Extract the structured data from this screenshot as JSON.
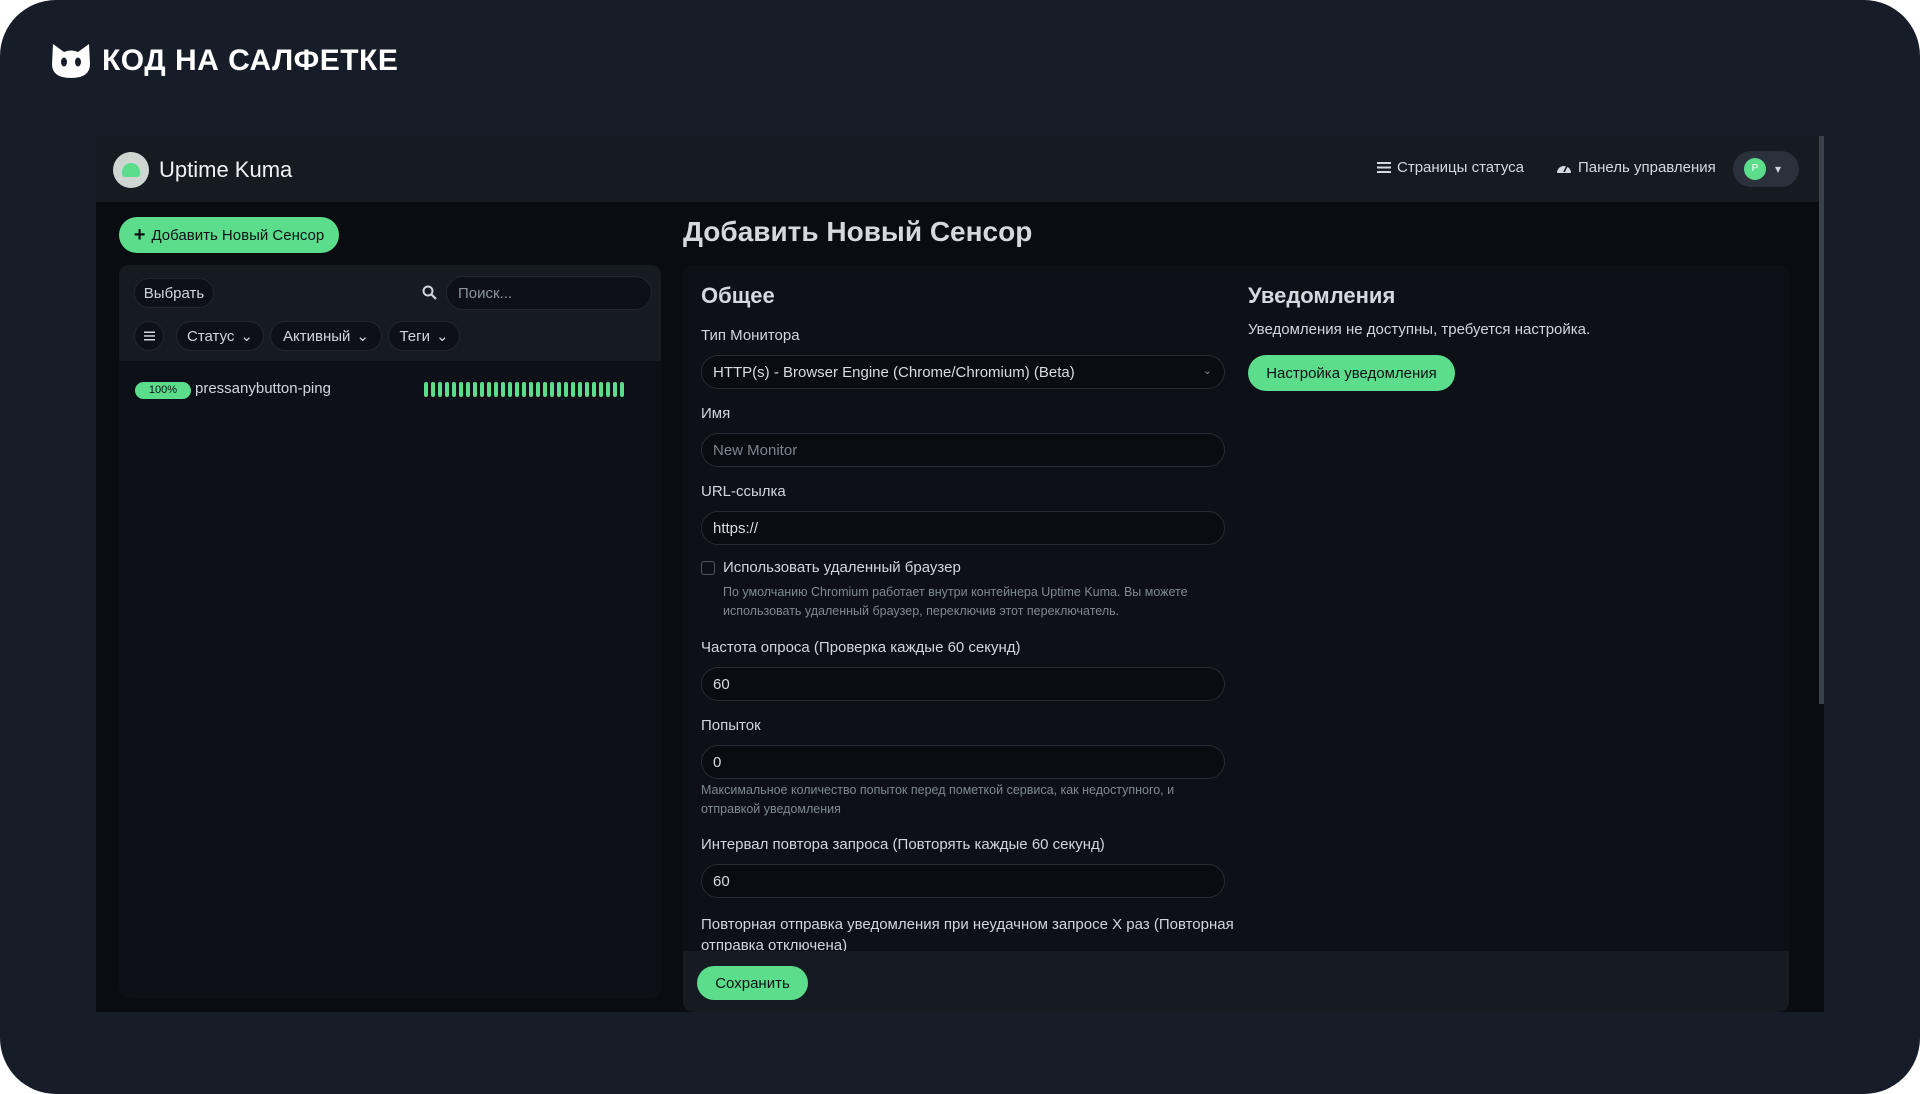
{
  "brand": {
    "name": "КОД НА САЛФЕТКЕ",
    "icon": "cat-head-icon"
  },
  "header": {
    "app_title": "Uptime Kuma",
    "status_pages_label": "Страницы статуса",
    "dashboard_label": "Панель управления",
    "avatar_letter": "P"
  },
  "sidebar": {
    "add_button_label": "Добавить Новый Сенсор",
    "select_label": "Выбрать",
    "search_placeholder": "Поиск...",
    "filters": [
      "Статус",
      "Активный",
      "Теги"
    ],
    "monitors": [
      {
        "name": "pressanybutton-ping",
        "uptime": "100%",
        "status": "up",
        "beats": 29
      }
    ]
  },
  "page": {
    "title": "Добавить Новый Сенсор"
  },
  "general": {
    "title": "Общее",
    "monitor_type_label": "Тип Монитора",
    "monitor_type_value": "HTTP(s) - Browser Engine (Chrome/Chromium) (Beta)",
    "name_label": "Имя",
    "name_placeholder": "New Monitor",
    "url_label": "URL-ссылка",
    "url_value": "https://",
    "remote_browser_label": "Использовать удаленный браузер",
    "remote_browser_hint_1": "По умолчанию Chromium работает внутри контейнера Uptime Kuma. Вы можете",
    "remote_browser_hint_2": "использовать удаленный браузер, переключив этот переключатель.",
    "interval_label": "Частота опроса (Проверка каждые 60 секунд)",
    "interval_value": "60",
    "retries_label": "Попыток",
    "retries_value": "0",
    "retries_hint_1": "Максимальное количество попыток перед пометкой сервиса, как недоступного, и",
    "retries_hint_2": "отправкой уведомления",
    "retry_interval_label": "Интервал повтора запроса (Повторять каждые 60 секунд)",
    "retry_interval_value": "60",
    "resend_label_1": "Повторная отправка уведомления при неудачном запросе X раз (Повторная",
    "resend_label_2": "отправка отключена)"
  },
  "notifications": {
    "title": "Уведомления",
    "empty_text": "Уведомления не доступны, требуется настройка.",
    "setup_button_label": "Настройка уведомления"
  },
  "footer": {
    "save_label": "Сохранить"
  },
  "colors": {
    "accent": "#5cdd8b",
    "frame_bg": "#171d28",
    "app_bg": "#090c10",
    "panel_bg": "#0d1117"
  }
}
